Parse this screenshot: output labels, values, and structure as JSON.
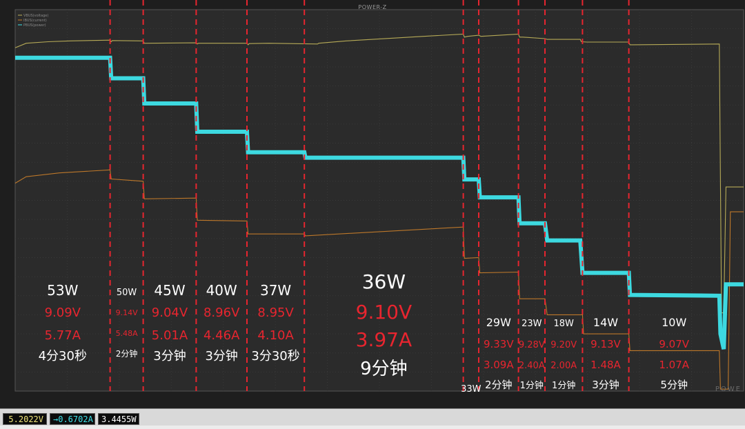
{
  "window_title": "POWER-Z",
  "watermark": "POWE",
  "legend": [
    "VBUS(voltage)",
    "IBUS(current)",
    "PBUS(power)"
  ],
  "colors": {
    "background": "#2b2b2b",
    "grid": "#3a3a3a",
    "voltage": "#bfb25a",
    "current": "#c67c2a",
    "power": "#3ee3ea",
    "divider": "#e8252f",
    "label_white": "#ffffff",
    "label_red": "#e8252f"
  },
  "chart_data": {
    "type": "line",
    "y_range": [
      0,
      10
    ],
    "series": [
      {
        "name": "VBUS(voltage)",
        "color": "#bfb25a",
        "points": [
          [
            0,
            9.0
          ],
          [
            0.5,
            9.12
          ],
          [
            1.5,
            9.16
          ],
          [
            2.5,
            9.18
          ],
          [
            4.3,
            9.2
          ],
          [
            4.35,
            9.16
          ],
          [
            4.4,
            9.19
          ],
          [
            5.8,
            9.18
          ],
          [
            5.85,
            9.12
          ],
          [
            6,
            9.12
          ],
          [
            8.2,
            9.13
          ],
          [
            8.25,
            9.1
          ],
          [
            8.3,
            9.12
          ],
          [
            10.5,
            9.12
          ],
          [
            10.55,
            9.08
          ],
          [
            10.6,
            9.11
          ],
          [
            11.5,
            9.12
          ],
          [
            13.7,
            9.1
          ],
          [
            13.75,
            9.12
          ],
          [
            15,
            9.18
          ],
          [
            18.5,
            9.3
          ],
          [
            20.3,
            9.36
          ],
          [
            20.35,
            9.28
          ],
          [
            20.5,
            9.3
          ],
          [
            21,
            9.33
          ],
          [
            21.1,
            9.3
          ],
          [
            22.8,
            9.36
          ],
          [
            22.85,
            9.28
          ],
          [
            23,
            9.28
          ],
          [
            24,
            9.24
          ],
          [
            24.1,
            9.22
          ],
          [
            25.6,
            9.22
          ],
          [
            25.65,
            9.16
          ],
          [
            25.9,
            9.15
          ],
          [
            27.8,
            9.15
          ],
          [
            27.85,
            9.08
          ],
          [
            28,
            9.08
          ],
          [
            31.9,
            9.1
          ],
          [
            31.95,
            5.5
          ],
          [
            32.0,
            2.05
          ],
          [
            32.1,
            2.05
          ],
          [
            32.2,
            5.35
          ],
          [
            33,
            5.35
          ]
        ]
      },
      {
        "name": "IBUS(current)",
        "color": "#c67c2a",
        "points": [
          [
            0,
            5.45
          ],
          [
            0.5,
            5.62
          ],
          [
            2,
            5.72
          ],
          [
            4.3,
            5.8
          ],
          [
            4.35,
            5.56
          ],
          [
            5.8,
            5.5
          ],
          [
            5.85,
            5.04
          ],
          [
            8.2,
            5.06
          ],
          [
            8.25,
            4.48
          ],
          [
            10.5,
            4.46
          ],
          [
            10.55,
            4.12
          ],
          [
            13.1,
            4.12
          ],
          [
            13.15,
            4.07
          ],
          [
            20.3,
            4.3
          ],
          [
            20.35,
            3.48
          ],
          [
            21,
            3.5
          ],
          [
            21.05,
            3.1
          ],
          [
            22.8,
            3.12
          ],
          [
            22.85,
            2.42
          ],
          [
            24,
            2.42
          ],
          [
            24.1,
            2.0
          ],
          [
            25.7,
            2.0
          ],
          [
            25.75,
            1.5
          ],
          [
            27.8,
            1.5
          ],
          [
            27.85,
            1.06
          ],
          [
            31.9,
            1.06
          ],
          [
            31.95,
            0.05
          ],
          [
            32.3,
            0.05
          ],
          [
            32.4,
            4.7
          ],
          [
            33,
            4.7
          ]
        ]
      },
      {
        "name": "PBUS(power)",
        "color": "#3ee3ea",
        "points": [
          [
            0,
            8.74
          ],
          [
            4.3,
            8.74
          ],
          [
            4.35,
            8.2
          ],
          [
            5.8,
            8.2
          ],
          [
            5.85,
            7.54
          ],
          [
            8.2,
            7.54
          ],
          [
            8.25,
            6.8
          ],
          [
            10.5,
            6.8
          ],
          [
            10.55,
            6.26
          ],
          [
            13.1,
            6.26
          ],
          [
            13.15,
            6.12
          ],
          [
            20.3,
            6.12
          ],
          [
            20.35,
            5.55
          ],
          [
            21.0,
            5.55
          ],
          [
            21.05,
            5.08
          ],
          [
            22.8,
            5.08
          ],
          [
            22.85,
            4.4
          ],
          [
            24.0,
            4.4
          ],
          [
            24.1,
            3.95
          ],
          [
            25.6,
            3.95
          ],
          [
            25.7,
            3.1
          ],
          [
            27.8,
            3.1
          ],
          [
            27.85,
            2.52
          ],
          [
            31.9,
            2.5
          ],
          [
            31.95,
            1.5
          ],
          [
            32.1,
            1.1
          ],
          [
            32.2,
            2.8
          ],
          [
            33,
            2.8
          ]
        ]
      }
    ],
    "segments": [
      {
        "power": "53W",
        "voltage": "9.09V",
        "current": "5.77A",
        "duration": "4分30秒"
      },
      {
        "power": "50W",
        "voltage": "9.14V",
        "current": "5.48A",
        "duration": "2分钟"
      },
      {
        "power": "45W",
        "voltage": "9.04V",
        "current": "5.01A",
        "duration": "3分钟"
      },
      {
        "power": "40W",
        "voltage": "8.96V",
        "current": "4.46A",
        "duration": "3分钟"
      },
      {
        "power": "37W",
        "voltage": "8.95V",
        "current": "4.10A",
        "duration": "3分30秒"
      },
      {
        "power": "36W",
        "voltage": "9.10V",
        "current": "3.97A",
        "duration": "9分钟"
      },
      {
        "power": "33W",
        "voltage": "",
        "current": "",
        "duration": ""
      },
      {
        "power": "29W",
        "voltage": "9.33V",
        "current": "3.09A",
        "duration": "2分钟"
      },
      {
        "power": "23W",
        "voltage": "9.28V",
        "current": "2.40A",
        "duration": "1分钟"
      },
      {
        "power": "18W",
        "voltage": "9.20V",
        "current": "2.00A",
        "duration": "1分钟"
      },
      {
        "power": "14W",
        "voltage": "9.13V",
        "current": "1.48A",
        "duration": "3分钟"
      },
      {
        "power": "10W",
        "voltage": "9.07V",
        "current": "1.07A",
        "duration": "5分钟"
      }
    ],
    "dividers": [
      4.3,
      5.8,
      8.2,
      10.5,
      13.1,
      20.3,
      21.0,
      22.8,
      24.0,
      25.7,
      27.8
    ],
    "grid": true
  },
  "status": {
    "voltage": "5.2022V",
    "current": "→0.6702A",
    "power": "3.4455W"
  }
}
